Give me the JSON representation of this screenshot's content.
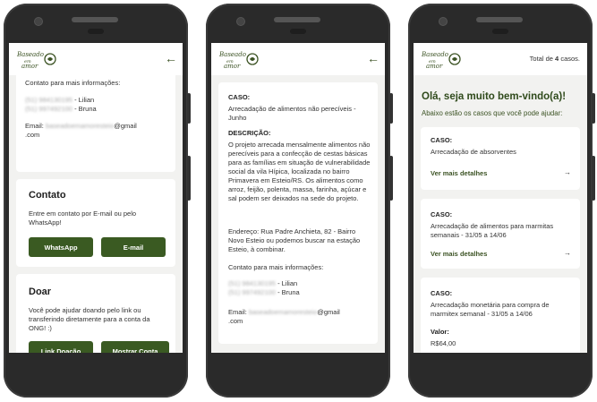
{
  "logo_text": "BASEADO EM AMOR",
  "icons": {
    "back": "arrow-left-icon",
    "next": "arrow-right-icon"
  },
  "colors": {
    "brand": "#3a5a22",
    "screen_bg": "#f2f2f0"
  },
  "phone1": {
    "contact_heading": "Contato para mais informações:",
    "phone1_blur": "(51) 984130195",
    "phone1_name": "- Lilian",
    "phone2_blur": "(51) 997492100",
    "phone2_name": "- Bruna",
    "email_label": "Email:",
    "email_blur": "baseadoemamoresteio",
    "email_domain": "@gmail",
    "email_tld": ".com",
    "contato_title": "Contato",
    "contato_text": "Entre em contato por E-mail ou pelo WhatsApp!",
    "whatsapp_label": "WhatsApp",
    "email_button_label": "E-mail",
    "doar_title": "Doar",
    "doar_text": "Você pode ajudar doando pelo link ou transferindo diretamente para a conta da ONG! :)",
    "link_doacao_label": "Link Doação",
    "mostrar_conta_label": "Mostrar Conta"
  },
  "phone2": {
    "caso_label": "CASO:",
    "caso_text": "Arrecadação de alimentos não perecíveis - Junho",
    "descricao_label": "DESCRIÇÃO:",
    "descricao_text": "O projeto arrecada mensalmente alimentos não perecíveis para a confecção de cestas básicas para as famílias em situação de vulnerabilidade social da vila Hípica, localizada no bairro Primavera em Esteio/RS.",
    "descricao_text2": "Os alimentos como arroz, feijão, polenta, massa, farinha, açúcar e sal podem ser deixados na sede do projeto.",
    "endereco_text": "Endereço: Rua Padre Anchieta, 82 - Bairro Novo Esteio ou podemos buscar na estação Esteio, à combinar.",
    "contact_heading": "Contato para mais informações:",
    "phone1_blur": "(51) 984130195",
    "phone1_name": "- Lilian",
    "phone2_blur": "(51) 997492100",
    "phone2_name": "- Bruna",
    "email_label": "Email:",
    "email_blur": "baseadoemamoresteio",
    "email_domain": "@gmail",
    "email_tld": ".com"
  },
  "phone3": {
    "total_prefix": "Total de",
    "total_count": "4",
    "total_suffix": "casos.",
    "welcome": "Olá, seja muito bem-vindo(a)!",
    "subtitle": "Abaixo estão os casos que você pode ajudar:",
    "cases": [
      {
        "label": "CASO:",
        "title": "Arrecadação de absorventes",
        "link": "Ver mais detalhes"
      },
      {
        "label": "CASO:",
        "title": "Arrecadação de alimentos para marmitas semanais - 31/05 a 14/06",
        "link": "Ver mais detalhes"
      },
      {
        "label": "CASO:",
        "title": "Arrecadação monetária para compra de marmitex semanal - 31/05 a 14/06",
        "value_label": "Valor:",
        "value": "R$64,00"
      }
    ]
  }
}
